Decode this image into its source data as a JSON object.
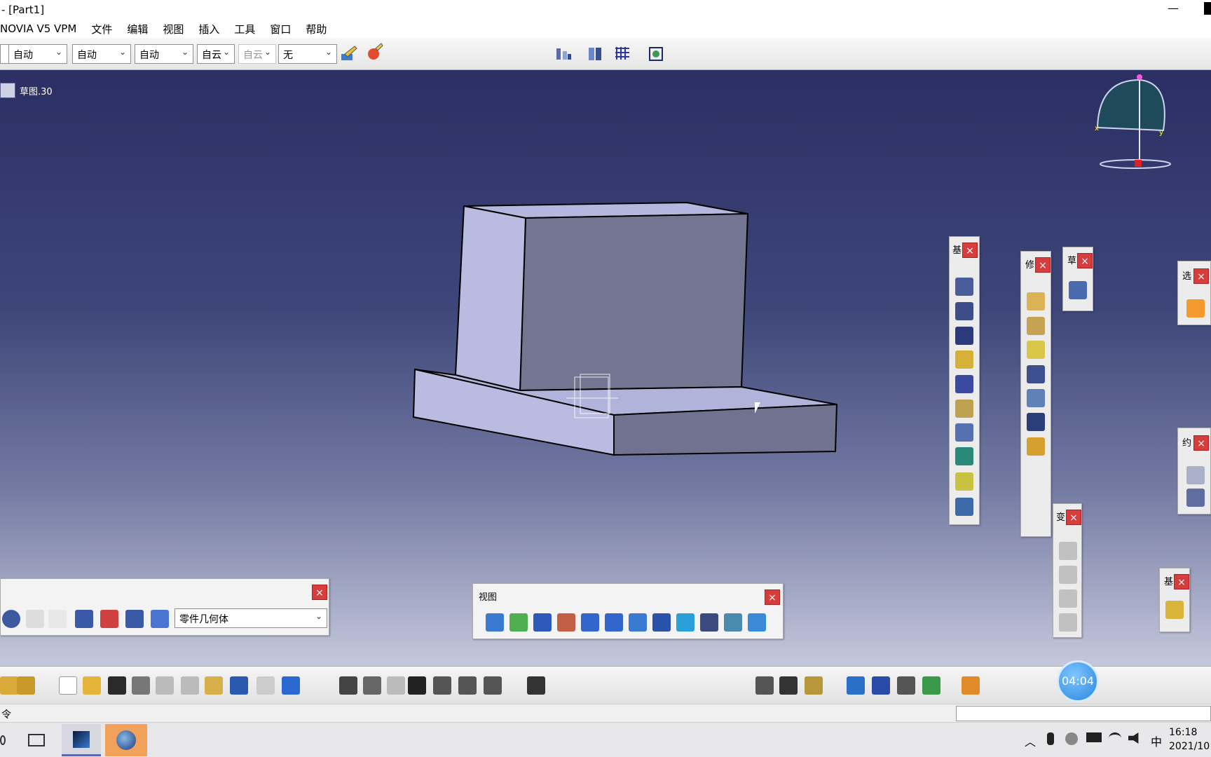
{
  "window": {
    "title": "- [Part1]",
    "minimize": "—"
  },
  "menu": {
    "items": [
      "NOVIA V5 VPM",
      "文件",
      "编辑",
      "视图",
      "插入",
      "工具",
      "窗口",
      "帮助"
    ]
  },
  "property_toolbar": {
    "combos": [
      {
        "value": "自动",
        "disabled": false
      },
      {
        "value": "自动",
        "disabled": false
      },
      {
        "value": "自动",
        "disabled": false
      },
      {
        "value": "自动",
        "disabled": false
      },
      {
        "value": "自动",
        "disabled": true
      },
      {
        "value": "无",
        "disabled": false
      }
    ],
    "combo_visible": [
      "自动",
      "自动",
      "自动",
      "自云",
      "自云",
      "无"
    ]
  },
  "tree": {
    "node_label": "草图.30"
  },
  "view_toolbar": {
    "title": "视图"
  },
  "tools_toolbar": {
    "body_select": "零件几何体"
  },
  "side_toolbar_labels": {
    "t1": "基",
    "t2": "修",
    "t3": "草",
    "t4": "选",
    "t5": "约",
    "t6": "变",
    "t7": "基"
  },
  "close_glyph": "×",
  "timer": {
    "text": "04:04"
  },
  "statusbar": {
    "prompt": "令"
  },
  "taskbar": {
    "lang": "中",
    "time": "16:18",
    "date": "2021/10"
  },
  "colors": {
    "accent_close": "#d63d3d",
    "viewport_top": "#2b2f63",
    "part_light": "#b9bce0",
    "part_dark": "#6f7390"
  }
}
